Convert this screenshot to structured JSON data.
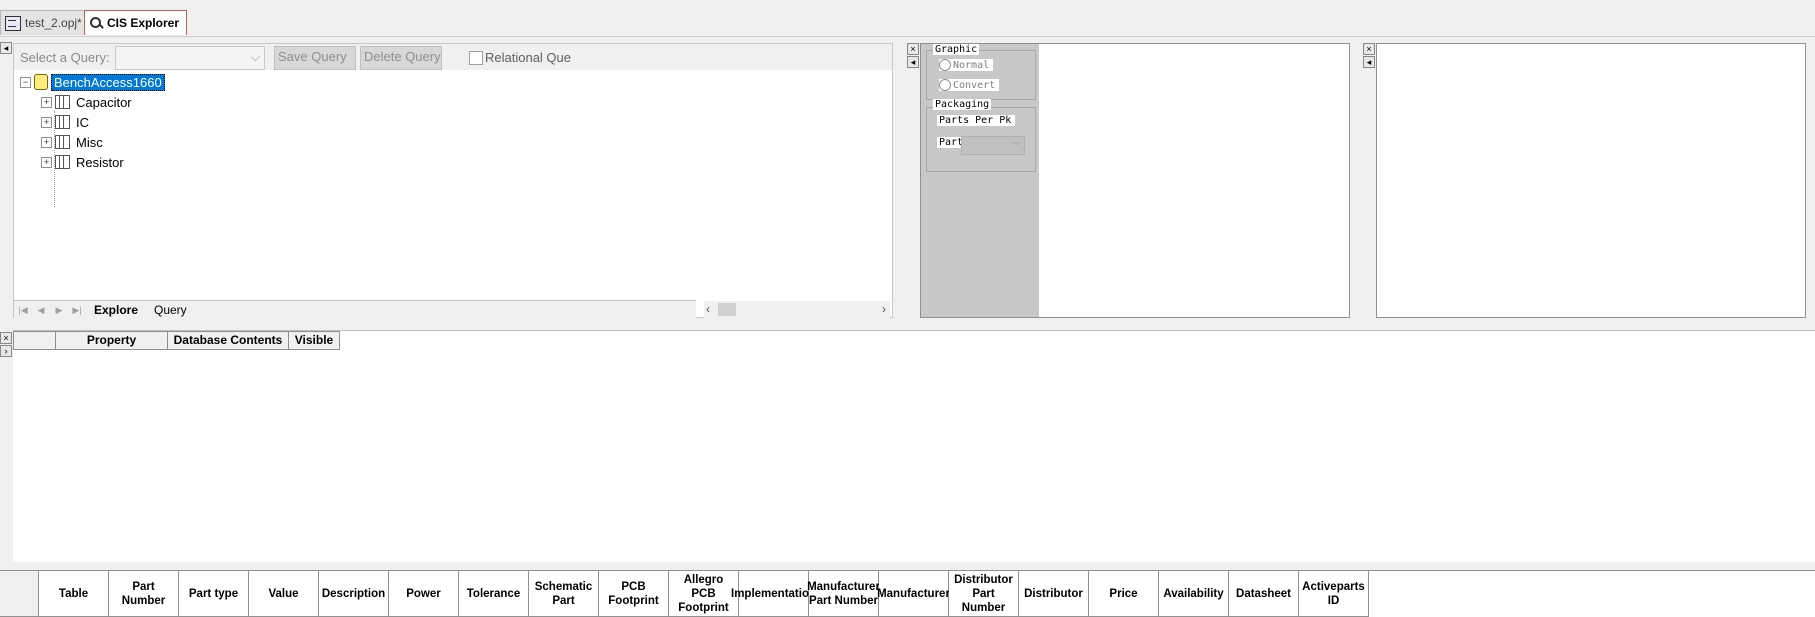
{
  "doc_tabs": [
    {
      "label": "test_2.opj*"
    },
    {
      "label": "CIS Explorer"
    }
  ],
  "query": {
    "label": "Select a Query:",
    "select_value": "",
    "save_label": "Save Query",
    "delete_label": "Delete Query",
    "relational_label": "Relational Que"
  },
  "tree": {
    "root": "BenchAccess1660",
    "items": [
      "Capacitor",
      "IC",
      "Misc",
      "Resistor"
    ]
  },
  "sheet_tabs": [
    "Explore",
    "Query"
  ],
  "props_panel": {
    "graphic_title": "Graphic",
    "normal_label": "Normal",
    "convert_label": "Convert",
    "packaging_title": "Packaging",
    "parts_per_pkg": "Parts Per Pk",
    "part_label": "Part"
  },
  "property_grid": {
    "headers": [
      "Property",
      "Database Contents",
      "Visible"
    ]
  },
  "parts_table": {
    "headers": [
      "Table",
      "Part Number",
      "Part type",
      "Value",
      "Description",
      "Power",
      "Tolerance",
      "Schematic Part",
      "PCB Footprint",
      "Allegro PCB Footprint",
      "Implementation",
      "Manufacturer Part Number",
      "Manufacturer",
      "Distributor Part Number",
      "Distributor",
      "Price",
      "Availability",
      "Datasheet",
      "Activeparts ID"
    ]
  },
  "icons": {
    "project": "project-file-icon",
    "explorer": "magnifier-icon",
    "database": "database-icon",
    "table": "table-icon"
  },
  "colors": {
    "selection": "#0078d7",
    "panel_gray": "#c8c8c8"
  }
}
